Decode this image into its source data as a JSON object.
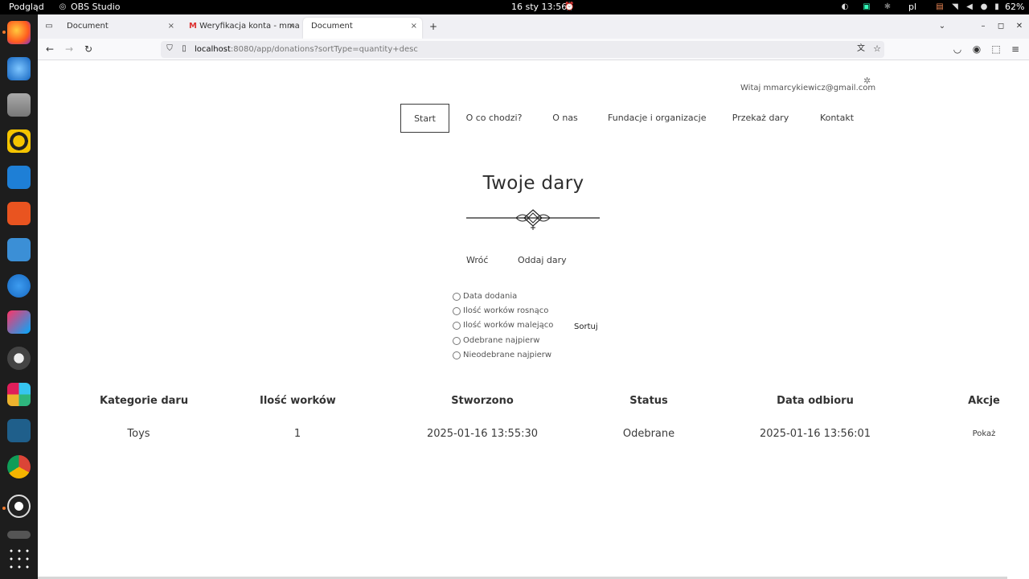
{
  "topbar": {
    "activities": "Podgląd",
    "app_name": "OBS Studio",
    "clock": "16 sty  13:56",
    "language": "pl",
    "battery": "62%"
  },
  "browser": {
    "tabs": [
      {
        "label": "Document",
        "close": "×"
      },
      {
        "label": "Weryfikacja konta - mmarc",
        "close": "×"
      },
      {
        "label": "Document",
        "close": "×"
      }
    ],
    "new_tab": "+",
    "url_host": "localhost",
    "url_rest": ":8080/app/donations?sortType=quantity+desc"
  },
  "header": {
    "greeting": "Witaj mmarcykiewicz@gmail.com",
    "menu": [
      {
        "label": "Start"
      },
      {
        "label": "O co chodzi?"
      },
      {
        "label": "O nas"
      },
      {
        "label": "Fundacje i organizacje"
      },
      {
        "label": "Przekaż dary"
      },
      {
        "label": "Kontakt"
      }
    ]
  },
  "main": {
    "title": "Twoje dary",
    "back_label": "Wróć",
    "give_label": "Oddaj dary",
    "sort_options": [
      {
        "label": "Data dodania"
      },
      {
        "label": "Ilość worków rosnąco"
      },
      {
        "label": "Ilość worków malejąco"
      },
      {
        "label": "Odebrane najpierw"
      },
      {
        "label": "Nieodebrane najpierw"
      }
    ],
    "sort_button": "Sortuj"
  },
  "table": {
    "headers": [
      "Kategorie daru",
      "Ilość worków",
      "Stworzono",
      "Status",
      "Data odbioru",
      "Akcje"
    ],
    "rows": [
      [
        "Toys",
        "1",
        "2025-01-16 13:55:30",
        "Odebrane",
        "2025-01-16 13:56:01",
        "Pokaż"
      ]
    ]
  },
  "colors": {
    "text": "#3b3b3b",
    "topbar": "#000000",
    "dock": "#1d1d1d"
  }
}
